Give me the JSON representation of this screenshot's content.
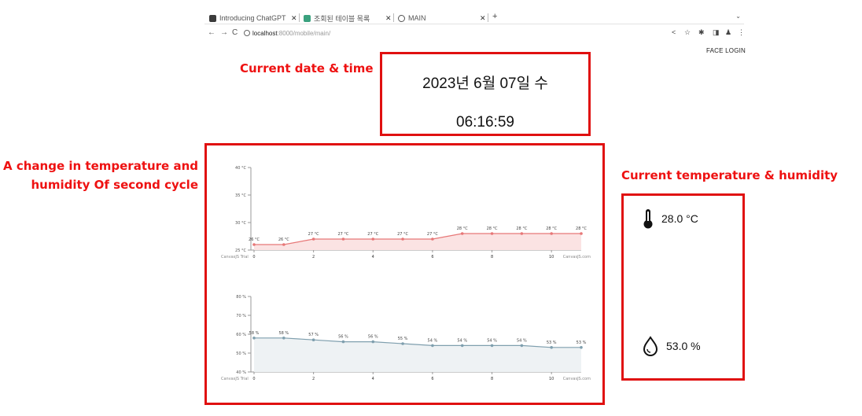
{
  "browser": {
    "tabs": [
      {
        "label": "Introducing ChatGPT",
        "favicon_color": "#3b3b3b"
      },
      {
        "label": "조회된 테이블 목록",
        "favicon_color": "#3aa17e"
      },
      {
        "label": "MAIN",
        "favicon_color": "#555555"
      }
    ],
    "new_tab": "+",
    "url_host": "localhost",
    "url_path": ":8000/mobile/main/"
  },
  "header": {
    "face_login": "FACE LOGIN"
  },
  "annotations": {
    "datetime": "Current date & time",
    "chart_line1": "A change in temperature and",
    "chart_line2": "humidity Of second cycle",
    "sensor": "Current temperature & humidity"
  },
  "clock": {
    "date": "2023년 6월 07일 수",
    "time": "06:16:59"
  },
  "sensor": {
    "temperature": "28.0 °C",
    "humidity": "53.0 %"
  },
  "colors": {
    "annotation": "#ee1111",
    "temp_series": "#e77777",
    "humidity_series": "#7f9fae"
  },
  "chart_data": [
    {
      "type": "area",
      "x": [
        0,
        1,
        2,
        3,
        4,
        5,
        6,
        7,
        8,
        9,
        10,
        11
      ],
      "values": [
        26,
        26,
        27,
        27,
        27,
        27,
        27,
        28,
        28,
        28,
        28,
        28
      ],
      "data_labels": [
        "26 °C",
        "26 °C",
        "27 °C",
        "27 °C",
        "27 °C",
        "27 °C",
        "27 °C",
        "28 °C",
        "28 °C",
        "28 °C",
        "28 °C",
        "28 °C"
      ],
      "x_ticks": [
        "0",
        "2",
        "4",
        "6",
        "8",
        "10"
      ],
      "y_ticks": [
        "40 °C",
        "35 °C",
        "30 °C",
        "25 °C"
      ],
      "ylim": [
        25,
        40
      ],
      "credit_left": "CanvasJS Trial",
      "credit_right": "CanvasJS.com"
    },
    {
      "type": "area",
      "x": [
        0,
        1,
        2,
        3,
        4,
        5,
        6,
        7,
        8,
        9,
        10,
        11
      ],
      "values": [
        58,
        58,
        57,
        56,
        56,
        55,
        54,
        54,
        54,
        54,
        53,
        53
      ],
      "data_labels": [
        "58 %",
        "58 %",
        "57 %",
        "56 %",
        "56 %",
        "55 %",
        "54 %",
        "54 %",
        "54 %",
        "54 %",
        "53 %",
        "53 %"
      ],
      "x_ticks": [
        "0",
        "2",
        "4",
        "6",
        "8",
        "10"
      ],
      "y_ticks": [
        "80 %",
        "70 %",
        "60 %",
        "50 %",
        "40 %"
      ],
      "ylim": [
        40,
        80
      ],
      "credit_left": "CanvasJS Trial",
      "credit_right": "CanvasJS.com"
    }
  ]
}
